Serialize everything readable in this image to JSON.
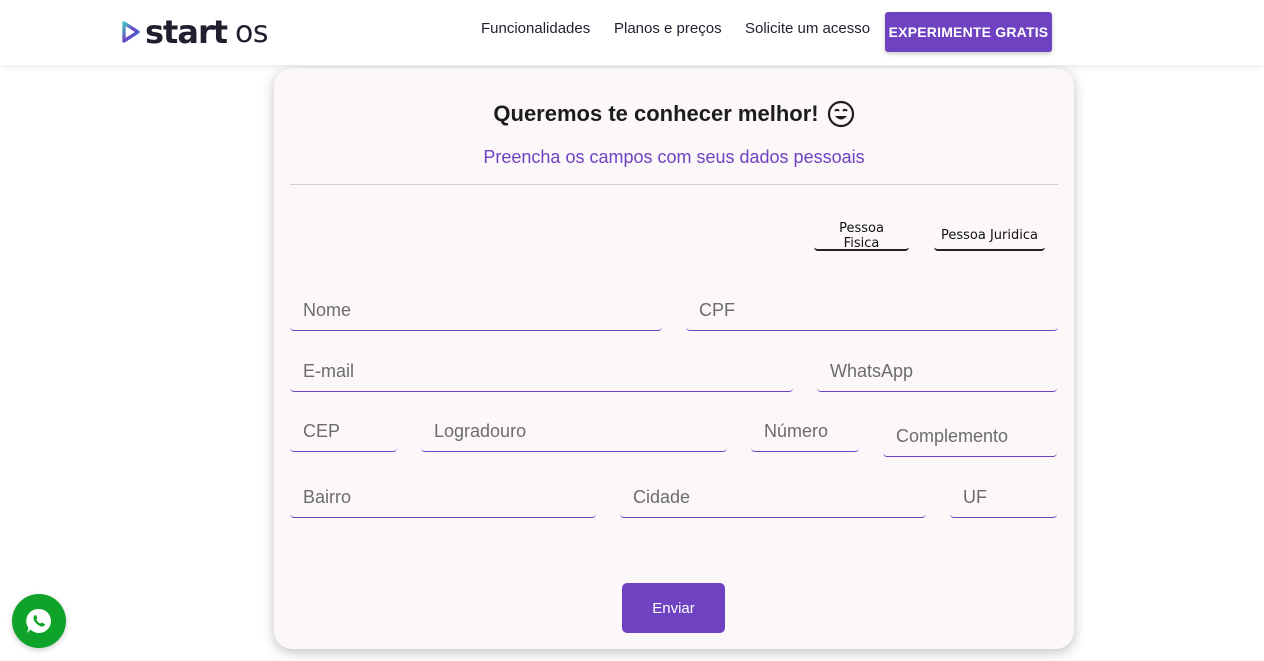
{
  "header": {
    "logo": {
      "start": "start",
      "os": "os"
    },
    "nav": [
      "Funcionalidades",
      "Planos e preços",
      "Solicite um acesso"
    ],
    "cta_label": "EXPERIMENTE GRATIS"
  },
  "form": {
    "title": "Queremos te conhecer melhor!",
    "title_icon": "smiling-face-icon",
    "subtitle": "Preencha os campos com seus dados pessoais",
    "person_types": [
      "Pessoa Fisica",
      "Pessoa Juridica"
    ],
    "placeholders": {
      "nome": "Nome",
      "cpf": "CPF",
      "email": "E-mail",
      "whatsapp": "WhatsApp",
      "cep": "CEP",
      "logradouro": "Logradouro",
      "numero": "Número",
      "complemento": "Complemento",
      "bairro": "Bairro",
      "cidade": "Cidade",
      "uf": "UF"
    },
    "submit_label": "Enviar"
  },
  "floating": {
    "icon": "whatsapp-icon"
  },
  "colors": {
    "accent": "#6f42c1",
    "whatsapp": "#0fa32a",
    "card_bg": "#fcf8fa"
  }
}
